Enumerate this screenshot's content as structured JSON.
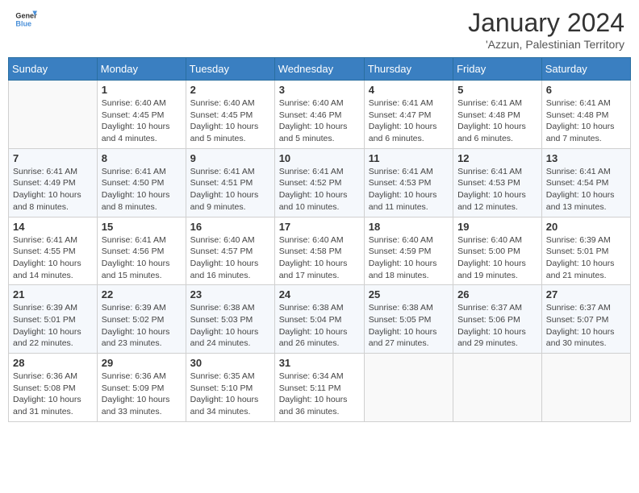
{
  "header": {
    "logo_general": "General",
    "logo_blue": "Blue",
    "month_title": "January 2024",
    "location": "'Azzun, Palestinian Territory"
  },
  "weekdays": [
    "Sunday",
    "Monday",
    "Tuesday",
    "Wednesday",
    "Thursday",
    "Friday",
    "Saturday"
  ],
  "weeks": [
    [
      {
        "day": "",
        "info": ""
      },
      {
        "day": "1",
        "info": "Sunrise: 6:40 AM\nSunset: 4:45 PM\nDaylight: 10 hours\nand 4 minutes."
      },
      {
        "day": "2",
        "info": "Sunrise: 6:40 AM\nSunset: 4:45 PM\nDaylight: 10 hours\nand 5 minutes."
      },
      {
        "day": "3",
        "info": "Sunrise: 6:40 AM\nSunset: 4:46 PM\nDaylight: 10 hours\nand 5 minutes."
      },
      {
        "day": "4",
        "info": "Sunrise: 6:41 AM\nSunset: 4:47 PM\nDaylight: 10 hours\nand 6 minutes."
      },
      {
        "day": "5",
        "info": "Sunrise: 6:41 AM\nSunset: 4:48 PM\nDaylight: 10 hours\nand 6 minutes."
      },
      {
        "day": "6",
        "info": "Sunrise: 6:41 AM\nSunset: 4:48 PM\nDaylight: 10 hours\nand 7 minutes."
      }
    ],
    [
      {
        "day": "7",
        "info": "Sunrise: 6:41 AM\nSunset: 4:49 PM\nDaylight: 10 hours\nand 8 minutes."
      },
      {
        "day": "8",
        "info": "Sunrise: 6:41 AM\nSunset: 4:50 PM\nDaylight: 10 hours\nand 8 minutes."
      },
      {
        "day": "9",
        "info": "Sunrise: 6:41 AM\nSunset: 4:51 PM\nDaylight: 10 hours\nand 9 minutes."
      },
      {
        "day": "10",
        "info": "Sunrise: 6:41 AM\nSunset: 4:52 PM\nDaylight: 10 hours\nand 10 minutes."
      },
      {
        "day": "11",
        "info": "Sunrise: 6:41 AM\nSunset: 4:53 PM\nDaylight: 10 hours\nand 11 minutes."
      },
      {
        "day": "12",
        "info": "Sunrise: 6:41 AM\nSunset: 4:53 PM\nDaylight: 10 hours\nand 12 minutes."
      },
      {
        "day": "13",
        "info": "Sunrise: 6:41 AM\nSunset: 4:54 PM\nDaylight: 10 hours\nand 13 minutes."
      }
    ],
    [
      {
        "day": "14",
        "info": "Sunrise: 6:41 AM\nSunset: 4:55 PM\nDaylight: 10 hours\nand 14 minutes."
      },
      {
        "day": "15",
        "info": "Sunrise: 6:41 AM\nSunset: 4:56 PM\nDaylight: 10 hours\nand 15 minutes."
      },
      {
        "day": "16",
        "info": "Sunrise: 6:40 AM\nSunset: 4:57 PM\nDaylight: 10 hours\nand 16 minutes."
      },
      {
        "day": "17",
        "info": "Sunrise: 6:40 AM\nSunset: 4:58 PM\nDaylight: 10 hours\nand 17 minutes."
      },
      {
        "day": "18",
        "info": "Sunrise: 6:40 AM\nSunset: 4:59 PM\nDaylight: 10 hours\nand 18 minutes."
      },
      {
        "day": "19",
        "info": "Sunrise: 6:40 AM\nSunset: 5:00 PM\nDaylight: 10 hours\nand 19 minutes."
      },
      {
        "day": "20",
        "info": "Sunrise: 6:39 AM\nSunset: 5:01 PM\nDaylight: 10 hours\nand 21 minutes."
      }
    ],
    [
      {
        "day": "21",
        "info": "Sunrise: 6:39 AM\nSunset: 5:01 PM\nDaylight: 10 hours\nand 22 minutes."
      },
      {
        "day": "22",
        "info": "Sunrise: 6:39 AM\nSunset: 5:02 PM\nDaylight: 10 hours\nand 23 minutes."
      },
      {
        "day": "23",
        "info": "Sunrise: 6:38 AM\nSunset: 5:03 PM\nDaylight: 10 hours\nand 24 minutes."
      },
      {
        "day": "24",
        "info": "Sunrise: 6:38 AM\nSunset: 5:04 PM\nDaylight: 10 hours\nand 26 minutes."
      },
      {
        "day": "25",
        "info": "Sunrise: 6:38 AM\nSunset: 5:05 PM\nDaylight: 10 hours\nand 27 minutes."
      },
      {
        "day": "26",
        "info": "Sunrise: 6:37 AM\nSunset: 5:06 PM\nDaylight: 10 hours\nand 29 minutes."
      },
      {
        "day": "27",
        "info": "Sunrise: 6:37 AM\nSunset: 5:07 PM\nDaylight: 10 hours\nand 30 minutes."
      }
    ],
    [
      {
        "day": "28",
        "info": "Sunrise: 6:36 AM\nSunset: 5:08 PM\nDaylight: 10 hours\nand 31 minutes."
      },
      {
        "day": "29",
        "info": "Sunrise: 6:36 AM\nSunset: 5:09 PM\nDaylight: 10 hours\nand 33 minutes."
      },
      {
        "day": "30",
        "info": "Sunrise: 6:35 AM\nSunset: 5:10 PM\nDaylight: 10 hours\nand 34 minutes."
      },
      {
        "day": "31",
        "info": "Sunrise: 6:34 AM\nSunset: 5:11 PM\nDaylight: 10 hours\nand 36 minutes."
      },
      {
        "day": "",
        "info": ""
      },
      {
        "day": "",
        "info": ""
      },
      {
        "day": "",
        "info": ""
      }
    ]
  ]
}
